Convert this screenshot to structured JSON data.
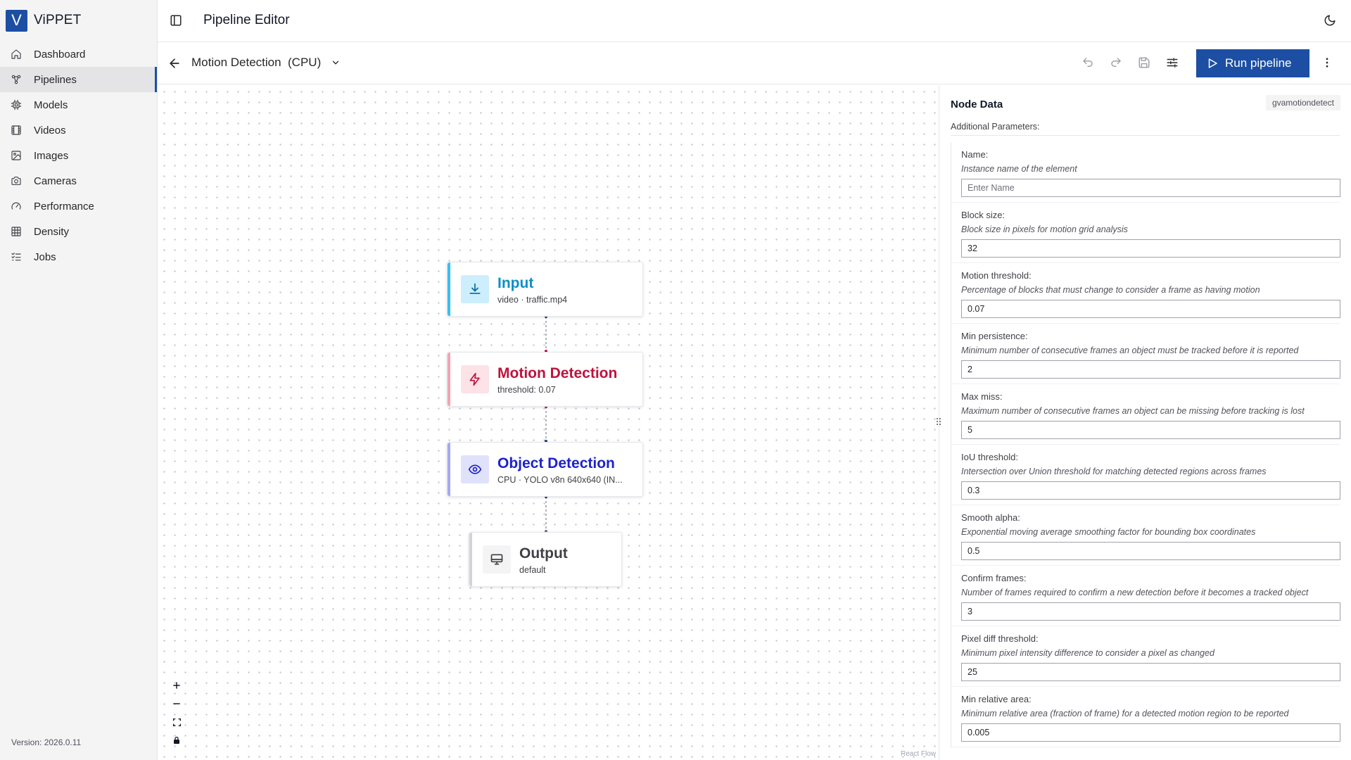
{
  "app": {
    "name": "ViPPET",
    "logo_letter": "V",
    "brand_color": "#1c4fa3",
    "version": "Version: 2026.0.11"
  },
  "sidebar": {
    "items": [
      {
        "label": "Dashboard",
        "icon": "home-icon"
      },
      {
        "label": "Pipelines",
        "icon": "workflow-icon",
        "active": true
      },
      {
        "label": "Models",
        "icon": "cpu-chip-icon"
      },
      {
        "label": "Videos",
        "icon": "film-icon"
      },
      {
        "label": "Images",
        "icon": "image-icon"
      },
      {
        "label": "Cameras",
        "icon": "camera-icon"
      },
      {
        "label": "Performance",
        "icon": "gauge-icon"
      },
      {
        "label": "Density",
        "icon": "grid-icon"
      },
      {
        "label": "Jobs",
        "icon": "list-checks-icon"
      }
    ]
  },
  "header": {
    "title": "Pipeline Editor"
  },
  "toolbar": {
    "pipeline_name": "Motion Detection  (CPU)",
    "run_label": "Run pipeline"
  },
  "canvas": {
    "nodes": {
      "input": {
        "title": "Input",
        "subtitle": "video · traffic.mp4",
        "color": "#0ea5e9"
      },
      "motion": {
        "title": "Motion Detection",
        "subtitle": "threshold: 0.07",
        "color": "#be123c"
      },
      "object": {
        "title": "Object Detection",
        "subtitle": "CPU · YOLO v8n 640x640 (IN...",
        "color": "#1d23c9"
      },
      "output": {
        "title": "Output",
        "subtitle": "default",
        "color": "#3f3f46"
      }
    },
    "attribution": "React Flow"
  },
  "panel": {
    "title": "Node Data",
    "element_tag": "gvamotiondetect",
    "section_label": "Additional Parameters:",
    "params": [
      {
        "label": "Name:",
        "description": "Instance name of the element",
        "value": "",
        "placeholder": "Enter Name"
      },
      {
        "label": "Block size:",
        "description": "Block size in pixels for motion grid analysis",
        "value": "32",
        "placeholder": ""
      },
      {
        "label": "Motion threshold:",
        "description": "Percentage of blocks that must change to consider a frame as having motion",
        "value": "0.07",
        "placeholder": ""
      },
      {
        "label": "Min persistence:",
        "description": "Minimum number of consecutive frames an object must be tracked before it is reported",
        "value": "2",
        "placeholder": ""
      },
      {
        "label": "Max miss:",
        "description": "Maximum number of consecutive frames an object can be missing before tracking is lost",
        "value": "5",
        "placeholder": ""
      },
      {
        "label": "IoU threshold:",
        "description": "Intersection over Union threshold for matching detected regions across frames",
        "value": "0.3",
        "placeholder": ""
      },
      {
        "label": "Smooth alpha:",
        "description": "Exponential moving average smoothing factor for bounding box coordinates",
        "value": "0.5",
        "placeholder": ""
      },
      {
        "label": "Confirm frames:",
        "description": "Number of frames required to confirm a new detection before it becomes a tracked object",
        "value": "3",
        "placeholder": ""
      },
      {
        "label": "Pixel diff threshold:",
        "description": "Minimum pixel intensity difference to consider a pixel as changed",
        "value": "25",
        "placeholder": ""
      },
      {
        "label": "Min relative area:",
        "description": "Minimum relative area (fraction of frame) for a detected motion region to be reported",
        "value": "0.005",
        "placeholder": ""
      }
    ]
  }
}
